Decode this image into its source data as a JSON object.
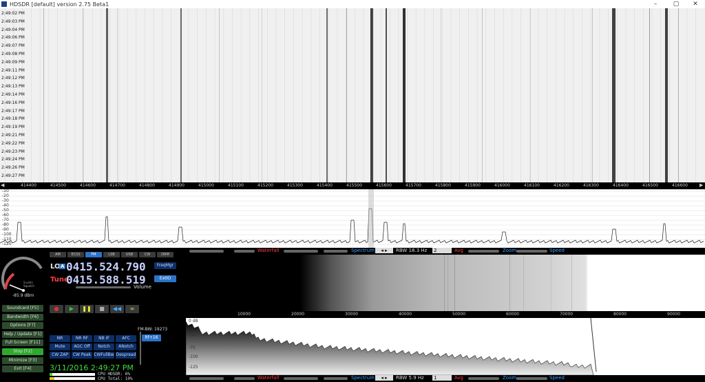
{
  "window": {
    "title": "HDSDR  [default]  version 2.75 Beta1",
    "minimize": "–",
    "maximize": "▢",
    "close": "✕"
  },
  "waterfall": {
    "times": [
      "2:49:02 PM",
      "2:49:03 PM",
      "2:49:04 PM",
      "2:49:06 PM",
      "2:49:07 PM",
      "2:49:08 PM",
      "2:49:09 PM",
      "2:49:11 PM",
      "2:49:12 PM",
      "2:49:13 PM",
      "2:49:14 PM",
      "2:49:16 PM",
      "2:49:17 PM",
      "2:49:18 PM",
      "2:49:19 PM",
      "2:49:21 PM",
      "2:49:22 PM",
      "2:49:23 PM",
      "2:49:24 PM",
      "2:49:26 PM",
      "2:49:27 PM"
    ]
  },
  "rf_axis": {
    "ticks": [
      "414400",
      "414500",
      "414600",
      "414700",
      "414800",
      "414900",
      "415000",
      "415100",
      "415200",
      "415300",
      "415400",
      "415500",
      "415600",
      "415700",
      "415800",
      "415900",
      "416000",
      "416100",
      "416200",
      "416300",
      "416400",
      "416500",
      "416600"
    ]
  },
  "rf_spectrum": {
    "db_labels": [
      "-10",
      "-20",
      "-30",
      "-40",
      "-50",
      "-60",
      "-70",
      "-80",
      "-90",
      "-100",
      "-110",
      "-120"
    ]
  },
  "strip": {
    "waterfall": "Waterfall",
    "spectrum": "Spectrum",
    "rbw_top": "RBW 18.3 Hz",
    "avg_value_top": "2",
    "avg": "Avg",
    "zoom": "Zoom",
    "speed": "Speed",
    "rbw_bottom": "RBW 5.9 Hz",
    "avg_value_bottom": "1"
  },
  "modes": [
    "AM",
    "ECSS",
    "FM",
    "LSB",
    "USB",
    "CW",
    "DRM"
  ],
  "smeter": {
    "reading": "-85.9 dBm",
    "squelch": "S-units Squelch",
    "scale": [
      "1",
      "3",
      "5",
      "7",
      "9",
      "+20",
      "+40",
      "+60"
    ]
  },
  "lo": {
    "prefix": "LO",
    "marker": "A",
    "value": "0415.524.790"
  },
  "tune": {
    "prefix": "Tune",
    "value": "0415.588.519"
  },
  "freqmgr": "FreqMgr",
  "extio": "ExtIO",
  "volume": "Volume",
  "function_buttons": [
    "Soundcard [F5]",
    "Bandwidth [F6]",
    "Options [F7]",
    "Help / Update [F1]",
    "Full Screen [F11]",
    "Stop [F2]",
    "Minimize [F3]",
    "Exit [F4]"
  ],
  "transport": [
    "●",
    "▶",
    "❚❚",
    "■",
    "◀◀",
    "∞"
  ],
  "fm_bw": "FM-BW: 19273",
  "rf_plus": "Rf+16",
  "dsp_buttons": [
    "NR",
    "NR RF",
    "NB IF",
    "AFC",
    "Mute",
    "AGC Off",
    "Notch",
    "ANotch",
    "CW ZAP",
    "CW Peak",
    "CWFullBw",
    "Despread"
  ],
  "datetime": "3/11/2016 2:49:27 PM",
  "cpu_hdsdr": "CPU HDSDR: 6%",
  "cpu_total": "CPU Total: 10%",
  "af_axis": {
    "ticks": [
      "10000",
      "20000",
      "30000",
      "40000",
      "50000",
      "60000",
      "70000",
      "80000",
      "90000"
    ]
  },
  "af_spectrum": {
    "db_labels": [
      "0 dB",
      "-50",
      "-75",
      "-100",
      "-125"
    ]
  },
  "colors": {
    "lo": "#e8e8e8",
    "tune": "#ff4040",
    "freq_digits": "#c8d0ff",
    "waterfall_label": "#ff4040",
    "spectrum_label": "#40a0ff",
    "avg_label": "#ff4040"
  }
}
